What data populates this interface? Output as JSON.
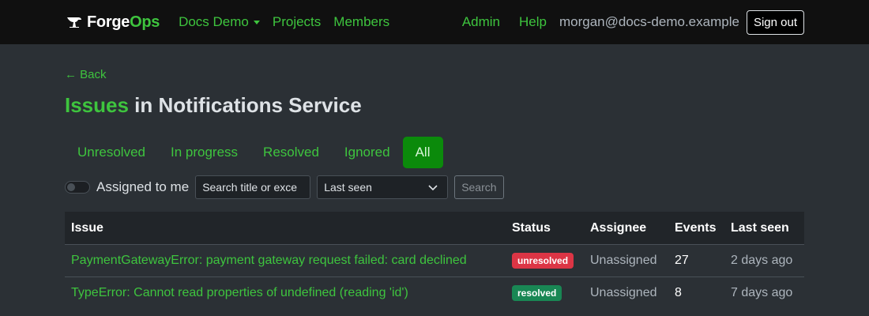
{
  "nav": {
    "brand_part1": "Forge",
    "brand_part2": "Ops",
    "org": "Docs Demo",
    "projects": "Projects",
    "members": "Members",
    "admin": "Admin",
    "help": "Help",
    "user_email": "morgan@docs-demo.example",
    "signout": "Sign out"
  },
  "page": {
    "back": "← Back",
    "title_accent": "Issues",
    "title_rest": " in Notifications Service"
  },
  "tabs": [
    {
      "label": "Unresolved",
      "active": false
    },
    {
      "label": "In progress",
      "active": false
    },
    {
      "label": "Resolved",
      "active": false
    },
    {
      "label": "Ignored",
      "active": false
    },
    {
      "label": "All",
      "active": true
    }
  ],
  "filters": {
    "assigned_label": "Assigned to me",
    "assigned_checked": false,
    "search_placeholder": "Search title or exce",
    "sort_value": "Last seen",
    "search_button": "Search"
  },
  "table": {
    "headers": [
      "Issue",
      "Status",
      "Assignee",
      "Events",
      "Last seen"
    ],
    "rows": [
      {
        "title": "PaymentGatewayError: payment gateway request failed: card declined",
        "status": "unresolved",
        "status_color": "#dc3545",
        "assignee": "Unassigned",
        "events": "27",
        "last_seen": "2 days ago"
      },
      {
        "title": "TypeError: Cannot read properties of undefined (reading 'id')",
        "status": "resolved",
        "status_color": "#198754",
        "assignee": "Unassigned",
        "events": "8",
        "last_seen": "7 days ago"
      }
    ]
  },
  "colors": {
    "accent": "#3ec43e",
    "topbar_bg": "#101010",
    "page_bg": "#2b3035",
    "active_tab_bg": "#0b8a0b"
  },
  "icons": {
    "brand": "anvil-icon",
    "back": "arrow-left-icon",
    "select": "chevron-down-icon"
  }
}
